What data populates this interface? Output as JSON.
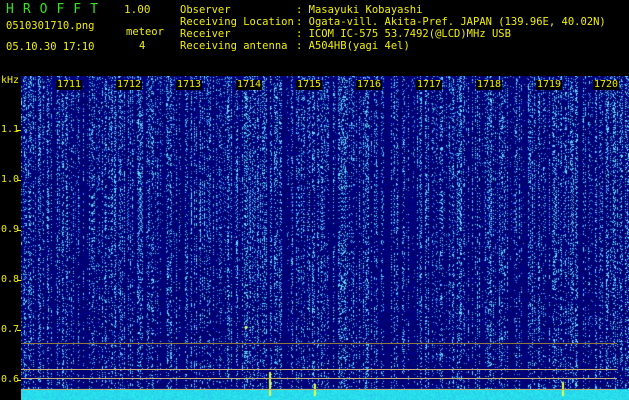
{
  "header": {
    "app_title": "HROFFT",
    "version": "1.00",
    "filename": "0510301710.png",
    "datetime": "05.10.30 17:10",
    "meteor_label": "meteor",
    "meteor_count": "4"
  },
  "station": {
    "observer_label": "Observer",
    "observer_value": ": Masayuki Kobayashi",
    "location_label": "Receiving Location",
    "location_value": ": Ogata-vill. Akita-Pref. JAPAN (139.96E, 40.02N)",
    "receiver_label": "Receiver",
    "receiver_value": ": ICOM IC-575 53.7492(@LCD)MHz USB",
    "antenna_label": "Receiving antenna",
    "antenna_value": ": A504HB(yagi 4el)"
  },
  "spectrogram": {
    "freq_unit": "kHz",
    "y_ticks": [
      "1.1",
      "1.0",
      "0.9",
      "0.8",
      "0.7",
      "0.6"
    ],
    "time_ticks": [
      "1711",
      "1712",
      "1713",
      "1714",
      "1715",
      "1716",
      "1717",
      "1718",
      "1719",
      "1720"
    ],
    "background_color": "#00007a",
    "signal_color": "#5ff0ff",
    "label_color": "#f0f000",
    "title_color": "#36e21b"
  }
}
